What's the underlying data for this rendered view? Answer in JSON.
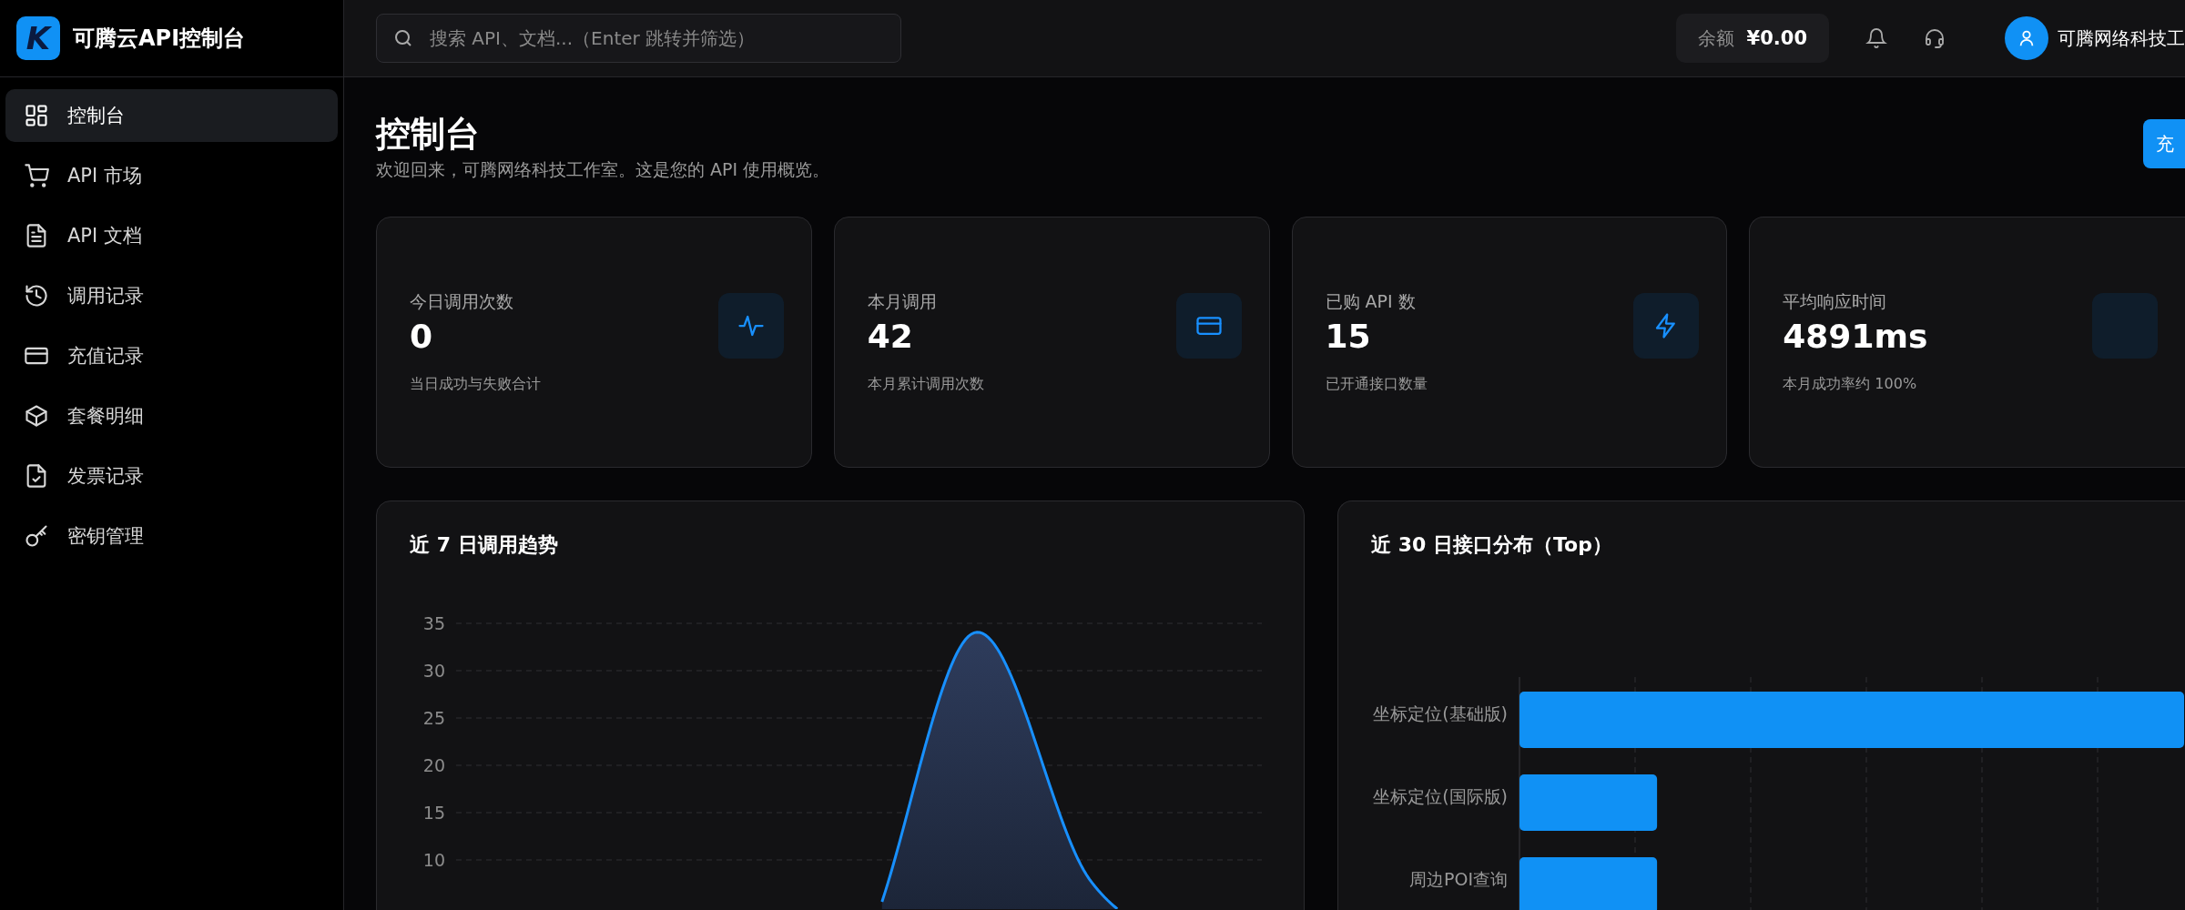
{
  "sidebar": {
    "brand": {
      "logo_text": "K",
      "title": "可腾云API控制台"
    },
    "items": [
      {
        "label": "控制台",
        "selected": true
      },
      {
        "label": "API 市场",
        "selected": false
      },
      {
        "label": "API 文档",
        "selected": false
      },
      {
        "label": "调用记录",
        "selected": false
      },
      {
        "label": "充值记录",
        "selected": false
      },
      {
        "label": "套餐明细",
        "selected": false
      },
      {
        "label": "发票记录",
        "selected": false
      },
      {
        "label": "密钥管理",
        "selected": false
      }
    ]
  },
  "header": {
    "search": {
      "placeholder": "搜索 API、文档...（Enter 跳转并筛选）"
    },
    "balance": {
      "label": "余额",
      "amount": "¥0.00"
    },
    "user": {
      "name": "可腾网络科技工"
    }
  },
  "page": {
    "title": "控制台",
    "subtitle": "欢迎回来，可腾网络科技工作室。这是您的 API 使用概览。",
    "action_button": "充"
  },
  "stats": [
    {
      "label": "今日调用次数",
      "value": "0",
      "note": "当日成功与失败合计"
    },
    {
      "label": "本月调用",
      "value": "42",
      "note": "本月累计调用次数"
    },
    {
      "label": "已购 API 数",
      "value": "15",
      "note": "已开通接口数量"
    },
    {
      "label": "平均响应时间",
      "value": "4891ms",
      "note": "本月成功率约 100%"
    }
  ],
  "trend": {
    "title": "近 7 日调用趋势",
    "axis_labels": [
      "35",
      "30",
      "25",
      "20",
      "15",
      "10"
    ]
  },
  "distribution": {
    "title": "近 30 日接口分布（Top）",
    "items": [
      {
        "label": "坐标定位(基础版)"
      },
      {
        "label": "坐标定位(国际版)"
      },
      {
        "label": "周边POI查询"
      }
    ]
  }
}
